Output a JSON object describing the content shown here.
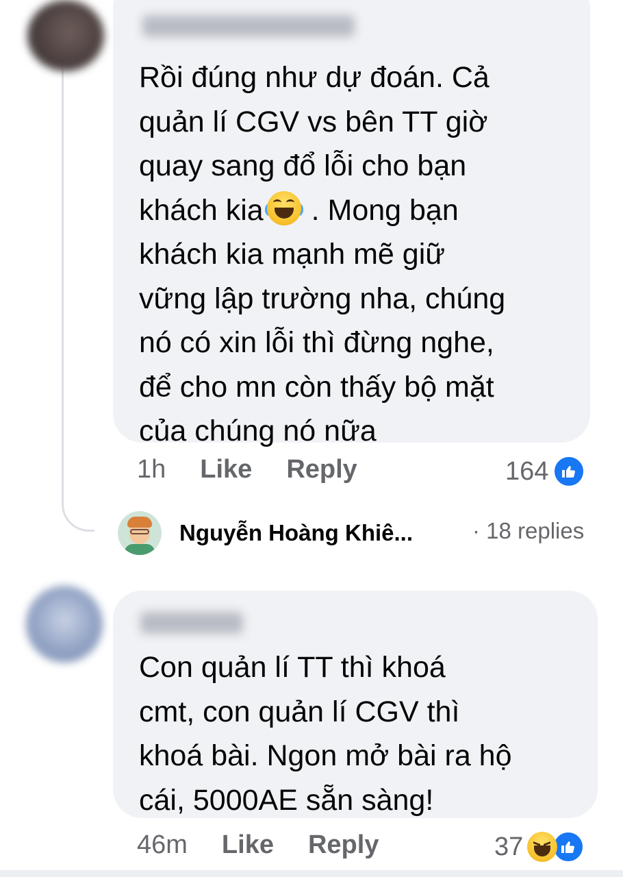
{
  "comments": [
    {
      "text_before_emoji": "Rồi đúng như dự đoán. Cả\nquản lí CGV vs bên TT giờ\nquay sang đổ lỗi cho bạn\nkhách kia",
      "text_after_emoji": " . Mong bạn\nkhách kia mạnh mẽ giữ\nvững lập trường nha, chúng\nnó có xin lỗi thì đừng nghe,\nđể cho mn còn thấy bộ mặt\ncủa chúng nó nữa",
      "inline_emoji": "tears-of-joy-emoji",
      "time": "1h",
      "like_label": "Like",
      "reply_label": "Reply",
      "reaction_count": "164",
      "reaction_icons": [
        "like-icon"
      ]
    },
    {
      "text": "Con quản lí  TT thì khoá\ncmt, con quản lí CGV thì\nkhoá bài. Ngon mở bài ra hộ\ncái, 5000AE sẵn sàng!",
      "time": "46m",
      "like_label": "Like",
      "reply_label": "Reply",
      "reaction_count": "37",
      "reaction_icons": [
        "haha-icon",
        "like-icon"
      ]
    }
  ],
  "replies_preview": {
    "name": "Nguyễn Hoàng Khiê...",
    "count_label": "· 18 replies"
  },
  "colors": {
    "bubble": "#f0f2f5",
    "text": "#050505",
    "meta": "#65676b",
    "like_blue": "#1877f2"
  }
}
